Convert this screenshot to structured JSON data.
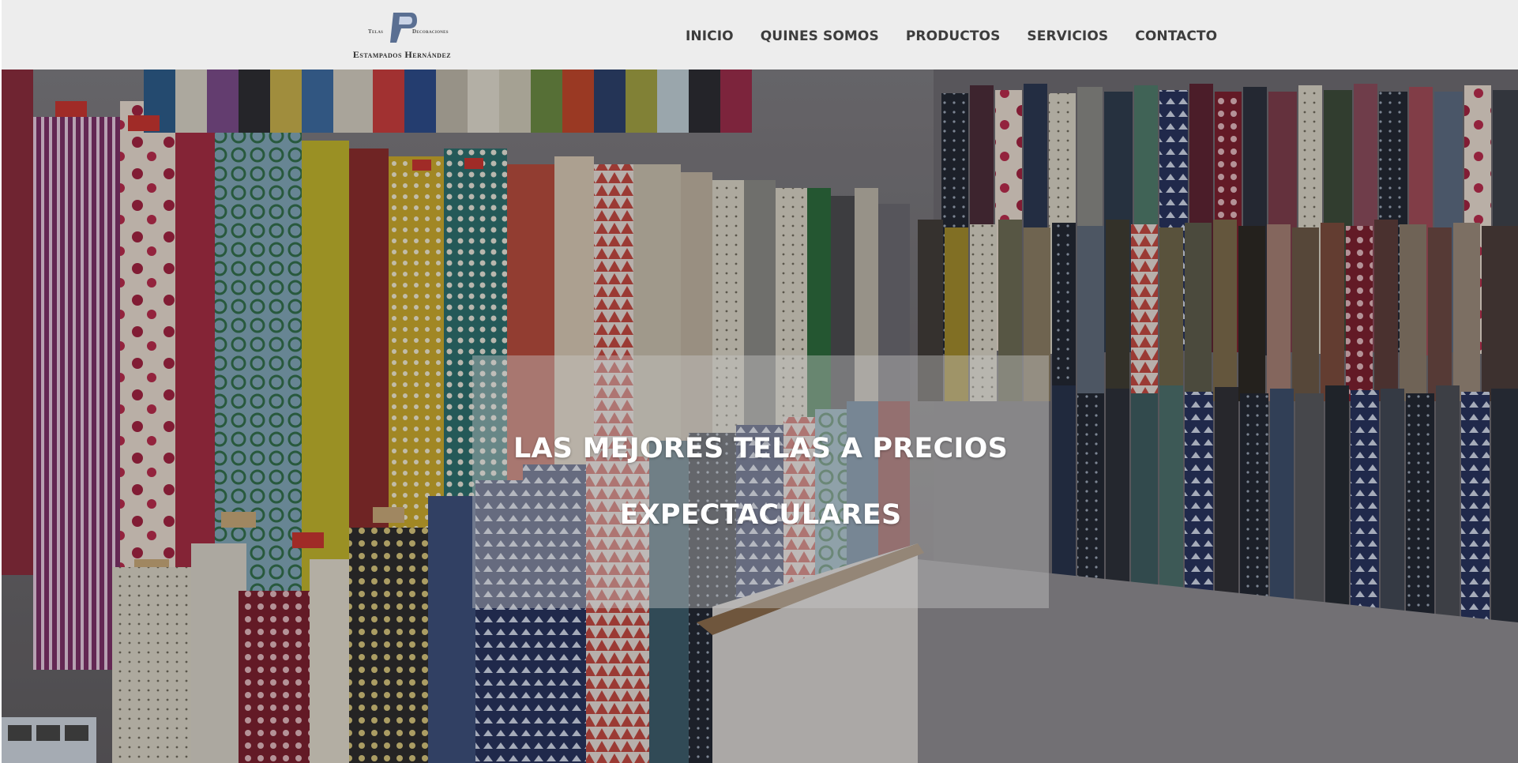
{
  "brand": {
    "small_left": "Telas",
    "small_right": "Decoraciones",
    "name": "Estampados Hernández",
    "mark_color": "#5a6f92"
  },
  "nav": {
    "items": [
      {
        "label": "INICIO"
      },
      {
        "label": "QUINES SOMOS"
      },
      {
        "label": "PRODUCTOS"
      },
      {
        "label": "SERVICIOS"
      },
      {
        "label": "CONTACTO"
      }
    ]
  },
  "hero": {
    "line1": "LAS MEJORES TELAS A PRECIOS",
    "line2": "EXPECTACULARES",
    "image": "fabric-rolls-photo"
  },
  "colors": {
    "header_bg": "#ededed",
    "nav_text": "#3d3d3d",
    "caption_text": "#ffffff"
  }
}
